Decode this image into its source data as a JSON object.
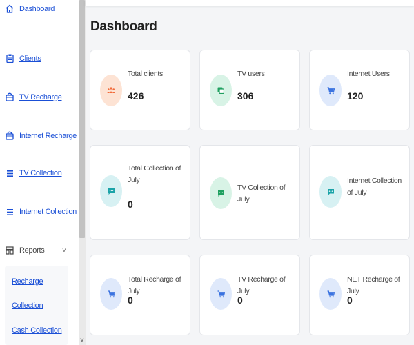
{
  "sidebar": {
    "items": [
      {
        "label": "Dashboard",
        "icon": "home-icon"
      },
      {
        "label": "Clients",
        "icon": "clipboard-icon"
      },
      {
        "label": "TV Recharge",
        "icon": "bag-icon"
      },
      {
        "label": "Internet Recharge",
        "icon": "bag-icon"
      },
      {
        "label": "TV Collection",
        "icon": "list-icon"
      },
      {
        "label": "Internet Collection",
        "icon": "list-icon"
      },
      {
        "label": "Reports",
        "icon": "report-icon",
        "chevron": "˅"
      }
    ],
    "submenu": [
      {
        "label": "Recharge"
      },
      {
        "label": "Collection"
      },
      {
        "label": "Cash Collection"
      }
    ],
    "bottom_chevron": "˅"
  },
  "main": {
    "title": "Dashboard",
    "cards": [
      {
        "label": "Total clients",
        "value": "426",
        "icon": "users-icon",
        "color": "#f26b3a"
      },
      {
        "label": "TV users",
        "value": "306",
        "icon": "tv-icon",
        "color": "#1fa060"
      },
      {
        "label": "Internet Users",
        "value": "120",
        "icon": "cart-icon",
        "color": "#3b73e0"
      },
      {
        "label": "Total Collection of July",
        "value": "0",
        "icon": "chat-icon",
        "color": "#1aa3a8"
      },
      {
        "label": "TV Collection of July",
        "value": "",
        "icon": "chat-icon",
        "color": "#1fa060"
      },
      {
        "label": "Internet Collection of July",
        "value": "",
        "icon": "chat-icon",
        "color": "#1aa3a8"
      },
      {
        "label": "Total Recharge of July",
        "value": "0",
        "icon": "cart-icon",
        "color": "#3b73e0"
      },
      {
        "label": "TV Recharge of July",
        "value": "0",
        "icon": "cart-icon",
        "color": "#3b73e0"
      },
      {
        "label": "NET Recharge of July",
        "value": "0",
        "icon": "cart-icon",
        "color": "#3b73e0"
      }
    ]
  }
}
